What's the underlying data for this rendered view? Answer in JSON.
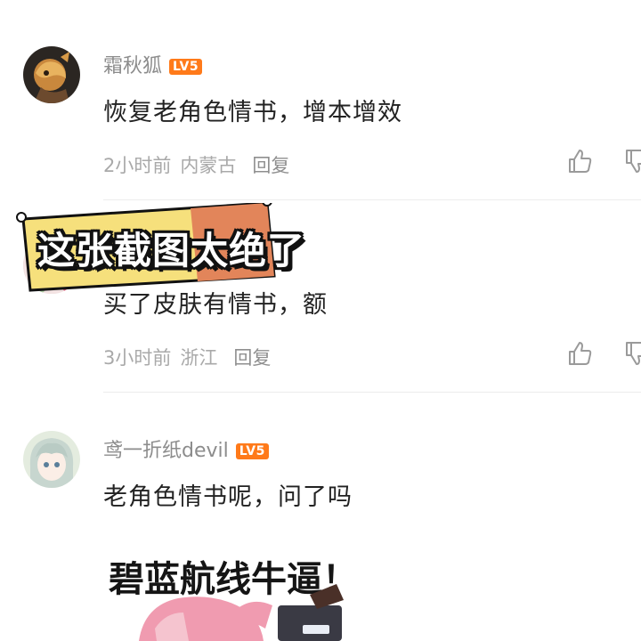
{
  "comments": [
    {
      "username": "霜秋狐",
      "level": "LV5",
      "text": "恢复老角色情书，增本增效",
      "time": "2小时前",
      "location": "内蒙古",
      "reply_label": "回复"
    },
    {
      "username": "",
      "level": "",
      "text": "买了皮肤有情书，额",
      "time": "3小时前",
      "location": "浙江",
      "reply_label": "回复"
    },
    {
      "username": "鸢一折纸devil",
      "level": "LV5",
      "text": "老角色情书呢，问了吗",
      "time": "",
      "location": "",
      "reply_label": ""
    }
  ],
  "overlay_banner": {
    "text": "这张截图太绝了"
  },
  "sticker": {
    "text": "碧蓝航线牛逼！"
  },
  "icons": {
    "like": "thumbs-up-icon",
    "dislike": "thumbs-down-icon"
  },
  "colors": {
    "level_badge": "#ff7a1a",
    "banner_yellow": "#f7e27a",
    "banner_orange": "#e8845a"
  }
}
